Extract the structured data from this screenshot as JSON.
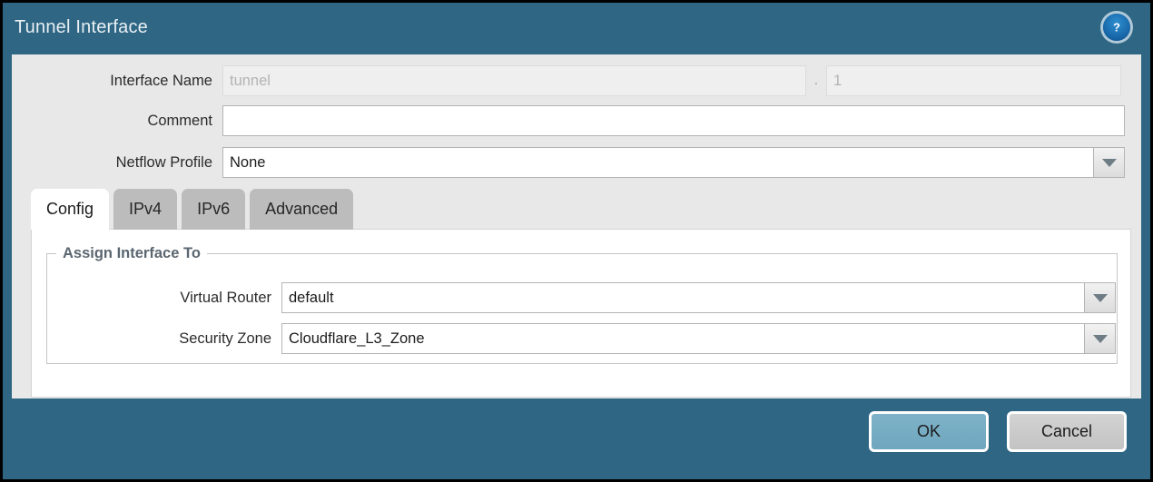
{
  "window": {
    "title": "Tunnel Interface",
    "help_icon": "help-circle-icon",
    "header_color": "#2e6684",
    "panel_color": "#e8e8e8"
  },
  "form": {
    "interface_name": {
      "label": "Interface Name",
      "prefix_value": "tunnel",
      "separator": ".",
      "suffix_value": "1"
    },
    "comment": {
      "label": "Comment",
      "value": ""
    },
    "netflow_profile": {
      "label": "Netflow Profile",
      "value": "None",
      "dropdown_icon": "chevron-down-icon"
    }
  },
  "tabs": [
    {
      "label": "Config",
      "active": true
    },
    {
      "label": "IPv4",
      "active": false
    },
    {
      "label": "IPv6",
      "active": false
    },
    {
      "label": "Advanced",
      "active": false
    }
  ],
  "config_tab": {
    "fieldset_legend": "Assign Interface To",
    "virtual_router": {
      "label": "Virtual Router",
      "value": "default",
      "dropdown_icon": "chevron-down-icon"
    },
    "security_zone": {
      "label": "Security Zone",
      "value": "Cloudflare_L3_Zone",
      "dropdown_icon": "chevron-down-icon"
    }
  },
  "footer": {
    "ok_label": "OK",
    "cancel_label": "Cancel",
    "ok_color": "#74aec4",
    "cancel_color": "#cbcbcb"
  }
}
